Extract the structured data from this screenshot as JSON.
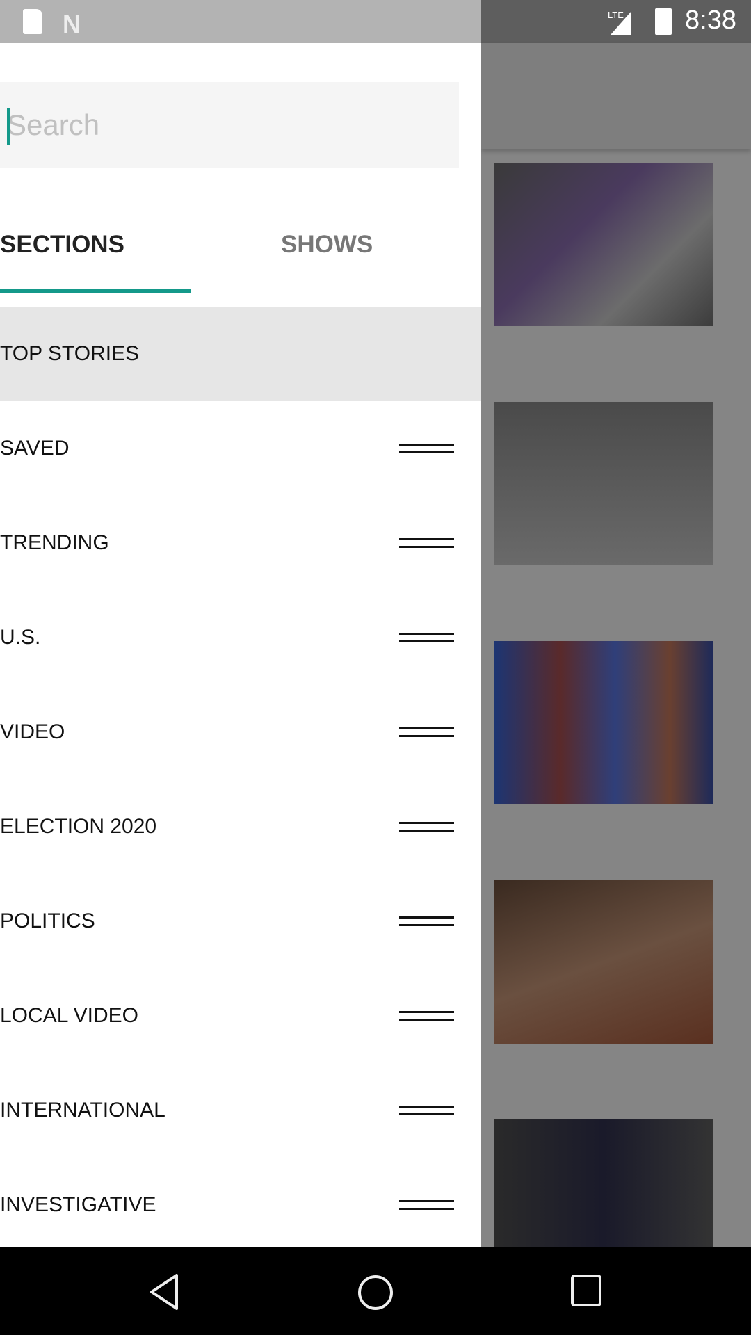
{
  "status_bar": {
    "time": "8:38",
    "network": "LTE",
    "icons": [
      "sd-card-icon",
      "n-logo-icon",
      "signal-icon",
      "battery-charging-icon"
    ]
  },
  "drawer": {
    "search": {
      "placeholder": "Search",
      "value": ""
    },
    "tabs": [
      {
        "label": "SECTIONS",
        "active": true
      },
      {
        "label": "SHOWS",
        "active": false
      }
    ],
    "items": [
      {
        "label": "TOP STORIES",
        "selected": true
      },
      {
        "label": "SAVED"
      },
      {
        "label": "TRENDING"
      },
      {
        "label": "U.S."
      },
      {
        "label": "VIDEO"
      },
      {
        "label": "ELECTION 2020"
      },
      {
        "label": "POLITICS"
      },
      {
        "label": "LOCAL VIDEO"
      },
      {
        "label": "INTERNATIONAL"
      },
      {
        "label": "INVESTIGATIVE"
      }
    ]
  },
  "colors": {
    "accent": "#14998a",
    "scrim": "#858585"
  },
  "nav_bar": {
    "buttons": [
      "back",
      "home",
      "recents"
    ]
  }
}
